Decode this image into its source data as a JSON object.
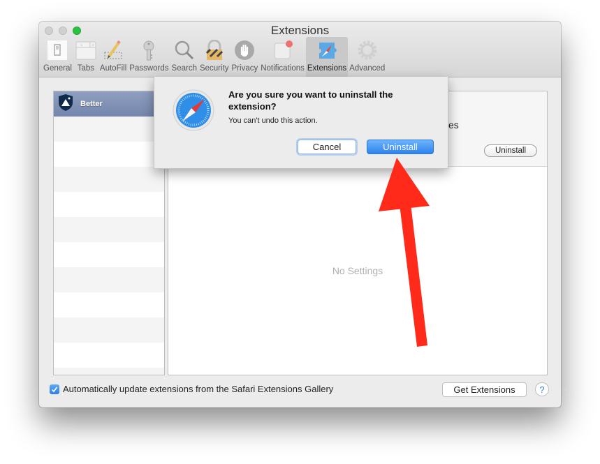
{
  "window": {
    "title": "Extensions",
    "traffic_lights": [
      "close",
      "minimize",
      "zoom"
    ]
  },
  "toolbar": {
    "items": [
      {
        "label": "General",
        "icon": "general-switch-icon"
      },
      {
        "label": "Tabs",
        "icon": "tabs-icon"
      },
      {
        "label": "AutoFill",
        "icon": "pencil-icon"
      },
      {
        "label": "Passwords",
        "icon": "key-icon"
      },
      {
        "label": "Search",
        "icon": "magnifier-icon"
      },
      {
        "label": "Security",
        "icon": "padlock-icon"
      },
      {
        "label": "Privacy",
        "icon": "hand-icon"
      },
      {
        "label": "Notifications",
        "icon": "notification-badge-icon"
      },
      {
        "label": "Extensions",
        "icon": "puzzle-compass-icon",
        "active": true
      },
      {
        "label": "Advanced",
        "icon": "gear-icon"
      }
    ]
  },
  "extension_list": {
    "items": [
      {
        "name": "Better",
        "selected": true
      }
    ]
  },
  "detail": {
    "description_fragment": "kes",
    "uninstall_label": "Uninstall",
    "no_settings": "No Settings"
  },
  "dialog": {
    "title": "Are you sure you want to uninstall the extension?",
    "message": "You can't undo this action.",
    "cancel_label": "Cancel",
    "confirm_label": "Uninstall"
  },
  "footer": {
    "auto_update_checked": true,
    "auto_update_label": "Automatically update extensions from the Safari Extensions Gallery",
    "get_extensions_label": "Get Extensions",
    "help_label": "?"
  },
  "annotation": {
    "type": "arrow",
    "color": "#ff2a1a",
    "points_to": "dialog-uninstall-button"
  }
}
